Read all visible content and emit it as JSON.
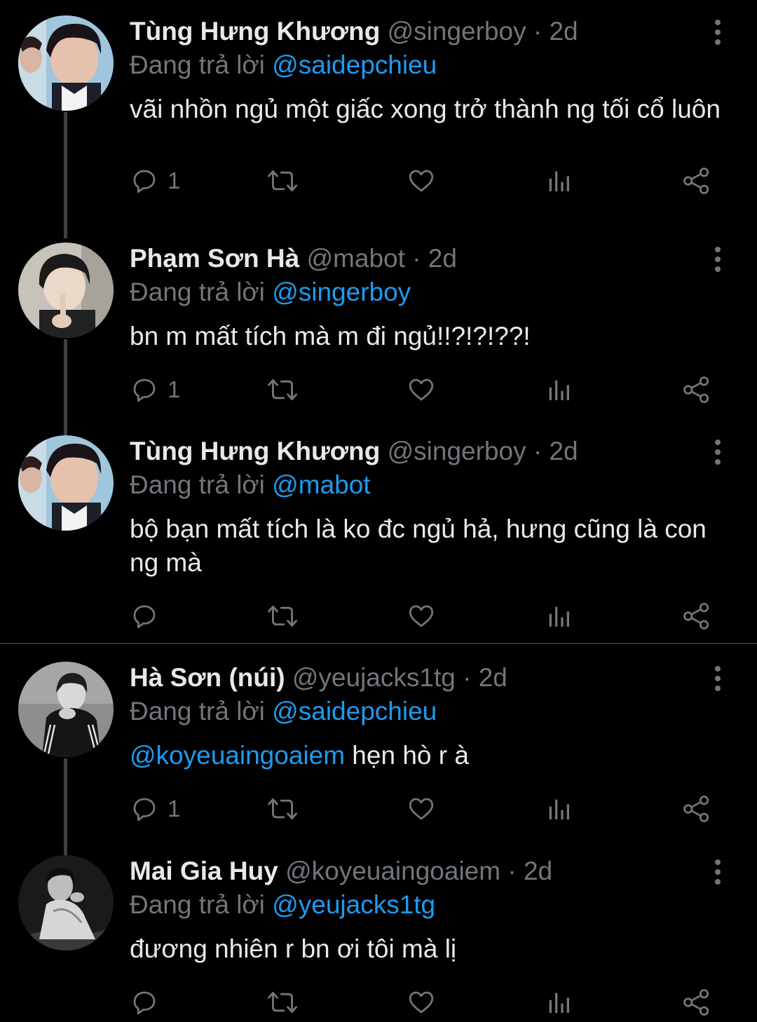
{
  "replying_prefix": "Đang trả lời",
  "colors": {
    "background": "#000000",
    "primary_text": "#e7e9ea",
    "secondary_text": "#71767b",
    "link": "#1d9bf0",
    "thread_line": "#3e4144"
  },
  "icons": {
    "more": "more-vertical-icon",
    "reply": "reply-icon",
    "retweet": "retweet-icon",
    "like": "like-icon",
    "views": "views-icon",
    "share": "share-icon"
  },
  "tweets": [
    {
      "name": "Tùng Hưng Khương",
      "handle": "@singerboy",
      "dot": "·",
      "time": "2d",
      "replying_to": "@saidepchieu",
      "text": "vãi nhồn ngủ một giấc xong trở thành ng tối cổ luôn",
      "mention": "",
      "reply_count": "1"
    },
    {
      "name": "Phạm Sơn Hà",
      "handle": "@mabot",
      "dot": "·",
      "time": "2d",
      "replying_to": "@singerboy",
      "text": "bn m mất tích mà m đi ngủ!!?!?!??!",
      "mention": "",
      "reply_count": "1"
    },
    {
      "name": "Tùng Hưng Khương",
      "handle": "@singerboy",
      "dot": "·",
      "time": "2d",
      "replying_to": "@mabot",
      "text": "bộ bạn mất tích là ko đc ngủ hả, hưng cũng là con ng mà",
      "mention": "",
      "reply_count": ""
    },
    {
      "name": "Hà Sơn (núi)",
      "handle": "@yeujacks1tg",
      "dot": "·",
      "time": "2d",
      "replying_to": "@saidepchieu",
      "text": " hẹn hò r à",
      "mention": "@koyeuaingoaiem",
      "reply_count": "1"
    },
    {
      "name": "Mai Gia Huy",
      "handle": "@koyeuaingoaiem",
      "dot": "·",
      "time": "2d",
      "replying_to": "@yeujacks1tg",
      "text": "đương nhiên r bn ơi tôi mà lị",
      "mention": "",
      "reply_count": ""
    }
  ]
}
